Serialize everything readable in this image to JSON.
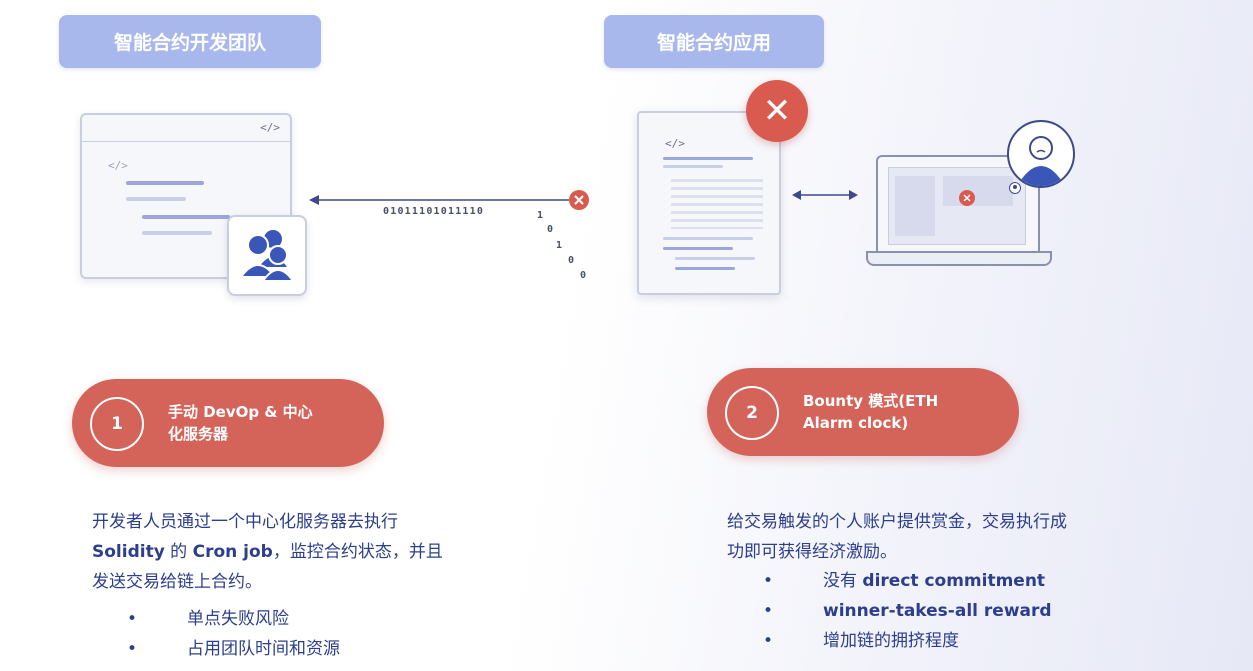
{
  "titles": {
    "left": "智能合约开发团队",
    "right": "智能合约应用"
  },
  "code_tag": "</>",
  "bit_stream": "01011101011110",
  "falling_bits": [
    "1",
    "0",
    "1",
    "0",
    "0"
  ],
  "steps": [
    {
      "number": "1",
      "label_line1": "手动 DevOp & 中心",
      "label_line2": "化服务器"
    },
    {
      "number": "2",
      "label_line1": "Bounty 模式(ETH",
      "label_line2": "Alarm clock)"
    }
  ],
  "left_description": {
    "line1": "开发者人员通过一个中心化服务器去执行",
    "line2_bold": "Solidity",
    "line2_mid": " 的 ",
    "line2_bold2": "Cron job",
    "line2_rest": "，监控合约状态，并且",
    "line3": "发送交易给链上合约。",
    "bullets": [
      "单点失败风险",
      "占用团队时间和资源"
    ]
  },
  "right_description": {
    "line1": "给交易触发的个人账户提供赏金，交易执行成",
    "line2": "功即可获得经济激励。",
    "bullets": [
      {
        "prefix": "没有 ",
        "bold": "direct commitment"
      },
      {
        "prefix": "",
        "bold": "winner-takes-all reward"
      },
      {
        "prefix": "增加链的拥挤程度",
        "bold": ""
      }
    ]
  },
  "bullet_char": "•",
  "icons": {
    "close": "close-icon",
    "team": "team-icon",
    "user": "user-avatar-icon"
  },
  "colors": {
    "title_pill": "#a9b8ec",
    "step_pill": "#d4635a",
    "error_red": "#d95a4f",
    "text_blue": "#2c3e8c",
    "team_blue": "#3a56b8"
  }
}
